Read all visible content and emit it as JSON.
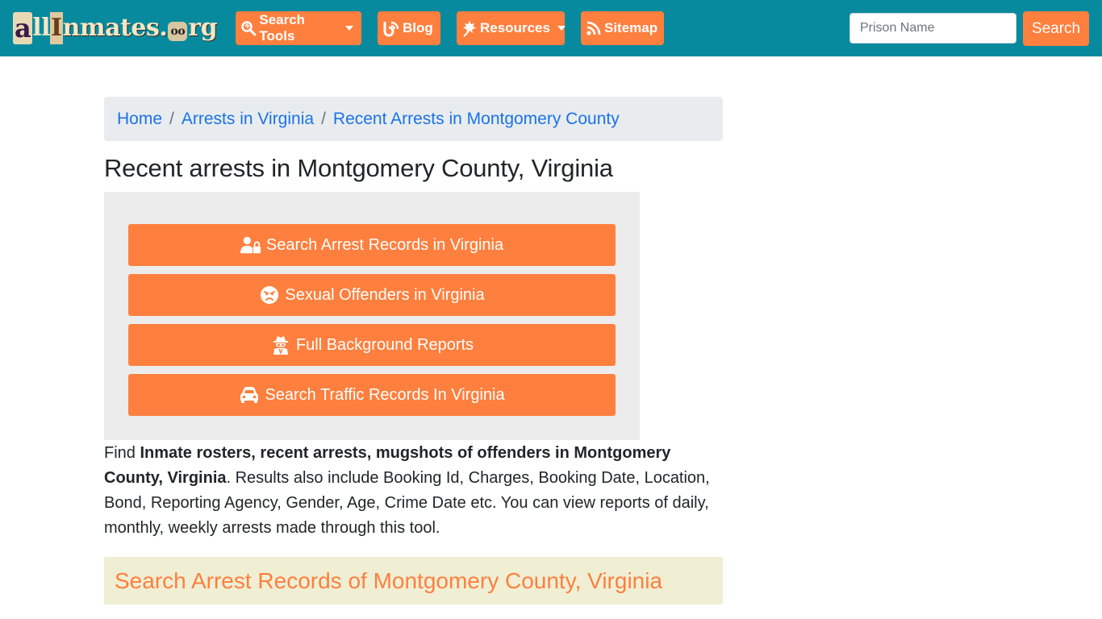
{
  "header": {
    "logo": {
      "a": "a",
      "ll": "ll",
      "i": "I",
      "rest": "nmates.",
      "o": "oo",
      "tail": "rg"
    },
    "nav": [
      {
        "label": "Search Tools",
        "icon": "search-tools-icon",
        "dropdown": true
      },
      {
        "label": "Blog",
        "icon": "blogger-icon",
        "dropdown": false
      },
      {
        "label": "Resources",
        "icon": "leaf-icon",
        "dropdown": true
      },
      {
        "label": "Sitemap",
        "icon": "rss-icon",
        "dropdown": false
      }
    ],
    "search": {
      "placeholder": "Prison Name",
      "value": "",
      "button_label": "Search"
    }
  },
  "breadcrumb": [
    {
      "label": "Home"
    },
    {
      "label": "Arrests in Virginia"
    },
    {
      "label": "Recent Arrests in Montgomery County"
    }
  ],
  "page_title": "Recent arrests in Montgomery County, Virginia",
  "actions": [
    {
      "label": "Search Arrest Records in Virginia",
      "icon": "user-lock-icon"
    },
    {
      "label": "Sexual Offenders in Virginia",
      "icon": "angry-face-icon"
    },
    {
      "label": "Full Background Reports",
      "icon": "user-secret-icon"
    },
    {
      "label": "Search Traffic Records In Virginia",
      "icon": "car-icon"
    }
  ],
  "description": {
    "prefix": "Find ",
    "bold": "Inmate rosters, recent arrests, mugshots of offenders in Montgomery County, Virginia",
    "suffix": ". Results also include Booking Id, Charges, Booking Date, Location, Bond, Reporting Agency, Gender, Age, Crime Date etc. You can view reports of daily, monthly, weekly arrests made through this tool."
  },
  "section_heading": "Search Arrest Records of Montgomery County, Virginia",
  "colors": {
    "navbar": "#078a9e",
    "accent": "#fe7f3e",
    "link": "#1a73e8",
    "panel": "#ececec",
    "section": "#f0efd4"
  }
}
